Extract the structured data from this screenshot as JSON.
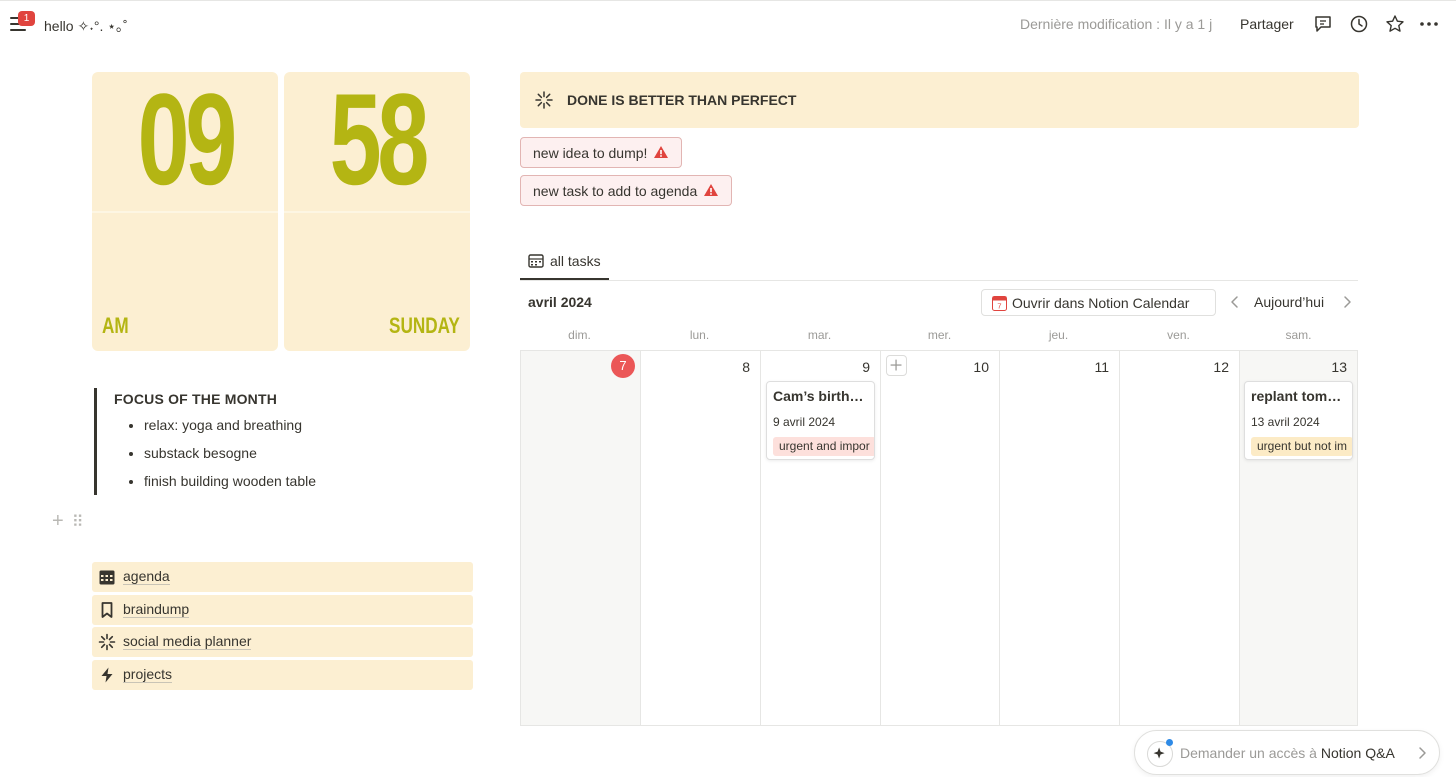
{
  "topbar": {
    "notification_count": "1",
    "page_title": "hello ✧˖°. ⋆｡˚",
    "last_edited": "Dernière modification : Il y a 1 j",
    "share_label": "Partager"
  },
  "clock": {
    "hours": "09",
    "minutes": "58",
    "period": "AM",
    "weekday": "SUNDAY"
  },
  "focus": {
    "title": "FOCUS OF THE MONTH",
    "items": [
      "relax: yoga and breathing",
      "substack besogne",
      "finish building wooden table"
    ]
  },
  "links": [
    {
      "label": "agenda",
      "icon": "calendar-icon"
    },
    {
      "label": "braindump",
      "icon": "bookmark-icon"
    },
    {
      "label": "social media planner",
      "icon": "sparkle-icon"
    },
    {
      "label": "projects",
      "icon": "bolt-icon"
    }
  ],
  "callout": {
    "text": "DONE IS BETTER THAN PERFECT",
    "icon": "sparkle-icon"
  },
  "buttons": {
    "new_idea": "new idea to dump!",
    "new_task": "new task to add to agenda"
  },
  "tabs": [
    {
      "label": "all tasks",
      "icon": "table-icon"
    }
  ],
  "calendar": {
    "month": "avril 2024",
    "open_in_calendar": "Ouvrir dans Notion Calendar",
    "today_label": "Aujourd’hui",
    "weekdays": [
      "dim.",
      "lun.",
      "mar.",
      "mer.",
      "jeu.",
      "ven.",
      "sam."
    ],
    "days": [
      "7",
      "8",
      "9",
      "10",
      "11",
      "12",
      "13"
    ],
    "today_day": "7",
    "events": [
      {
        "title": "Cam’s birth…",
        "date": "9 avril 2024",
        "tag": "urgent and impor",
        "tag_color": "#fde0dc",
        "day": "9"
      },
      {
        "title": "replant tom…",
        "date": "13 avril 2024",
        "tag": "urgent but not im",
        "tag_color": "#fcebc6",
        "day": "13"
      }
    ]
  },
  "qa": {
    "prefix": "Demander un accès à",
    "product": "Notion Q&A"
  },
  "colors": {
    "accent_olive": "#b4b513",
    "card_bg": "#fcefd2",
    "alert_red": "#e0443e"
  }
}
